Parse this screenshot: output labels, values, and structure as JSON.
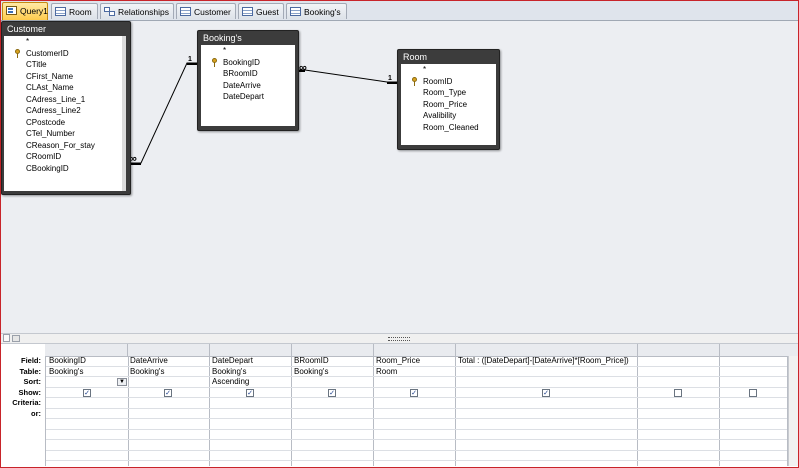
{
  "tabs": [
    {
      "label": "Query1",
      "icon": "query-icon",
      "active": true
    },
    {
      "label": "Room",
      "icon": "table-icon"
    },
    {
      "label": "Relationships",
      "icon": "relationships-icon"
    },
    {
      "label": "Customer",
      "icon": "table-icon"
    },
    {
      "label": "Guest",
      "icon": "table-icon"
    },
    {
      "label": "Booking's",
      "icon": "table-icon"
    }
  ],
  "tables": {
    "customer": {
      "title": "Customer",
      "fields": [
        "*",
        "CustomerID",
        "CTitle",
        "CFirst_Name",
        "CLAst_Name",
        "CAdress_Line_1",
        "CAdress_Line2",
        "CPostcode",
        "CTel_Number",
        "CReason_For_stay",
        "CRoomID",
        "CBookingID"
      ],
      "key_field": "CustomerID"
    },
    "booking": {
      "title": "Booking's",
      "fields": [
        "*",
        "BookingID",
        "BRoomID",
        "DateArrive",
        "DateDepart"
      ],
      "key_field": "BookingID"
    },
    "room": {
      "title": "Room",
      "fields": [
        "*",
        "RoomID",
        "Room_Type",
        "Room_Price",
        "Avalibility",
        "Room_Cleaned"
      ],
      "key_field": "RoomID"
    }
  },
  "relationships": [
    {
      "from_symbol": "1",
      "to_symbol": "∞"
    },
    {
      "from_symbol": "∞",
      "to_symbol": "1"
    }
  ],
  "grid": {
    "row_labels": [
      "Field:",
      "Table:",
      "Sort:",
      "Show:",
      "Criteria:",
      "or:"
    ],
    "columns": [
      {
        "field": "BookingID",
        "table": "Booking's",
        "sort": "",
        "show": true
      },
      {
        "field": "DateArrive",
        "table": "Booking's",
        "sort": "",
        "show": true
      },
      {
        "field": "DateDepart",
        "table": "Booking's",
        "sort": "Ascending",
        "show": true
      },
      {
        "field": "BRoomID",
        "table": "Booking's",
        "sort": "",
        "show": true
      },
      {
        "field": "Room_Price",
        "table": "Room",
        "sort": "",
        "show": true
      },
      {
        "field": "Total : ([DateDepart]-[DateArrive]*[Room_Price])",
        "table": "",
        "sort": "",
        "show": true
      },
      {
        "field": "",
        "table": "",
        "sort": "",
        "show": false
      },
      {
        "field": "",
        "table": "",
        "sort": "",
        "show": false
      }
    ]
  },
  "colors": {
    "frame": "#c8242a",
    "active_tab": "#ffcc4d",
    "table_header": "#3c3c3c",
    "pane_bg": "#eceef2"
  }
}
